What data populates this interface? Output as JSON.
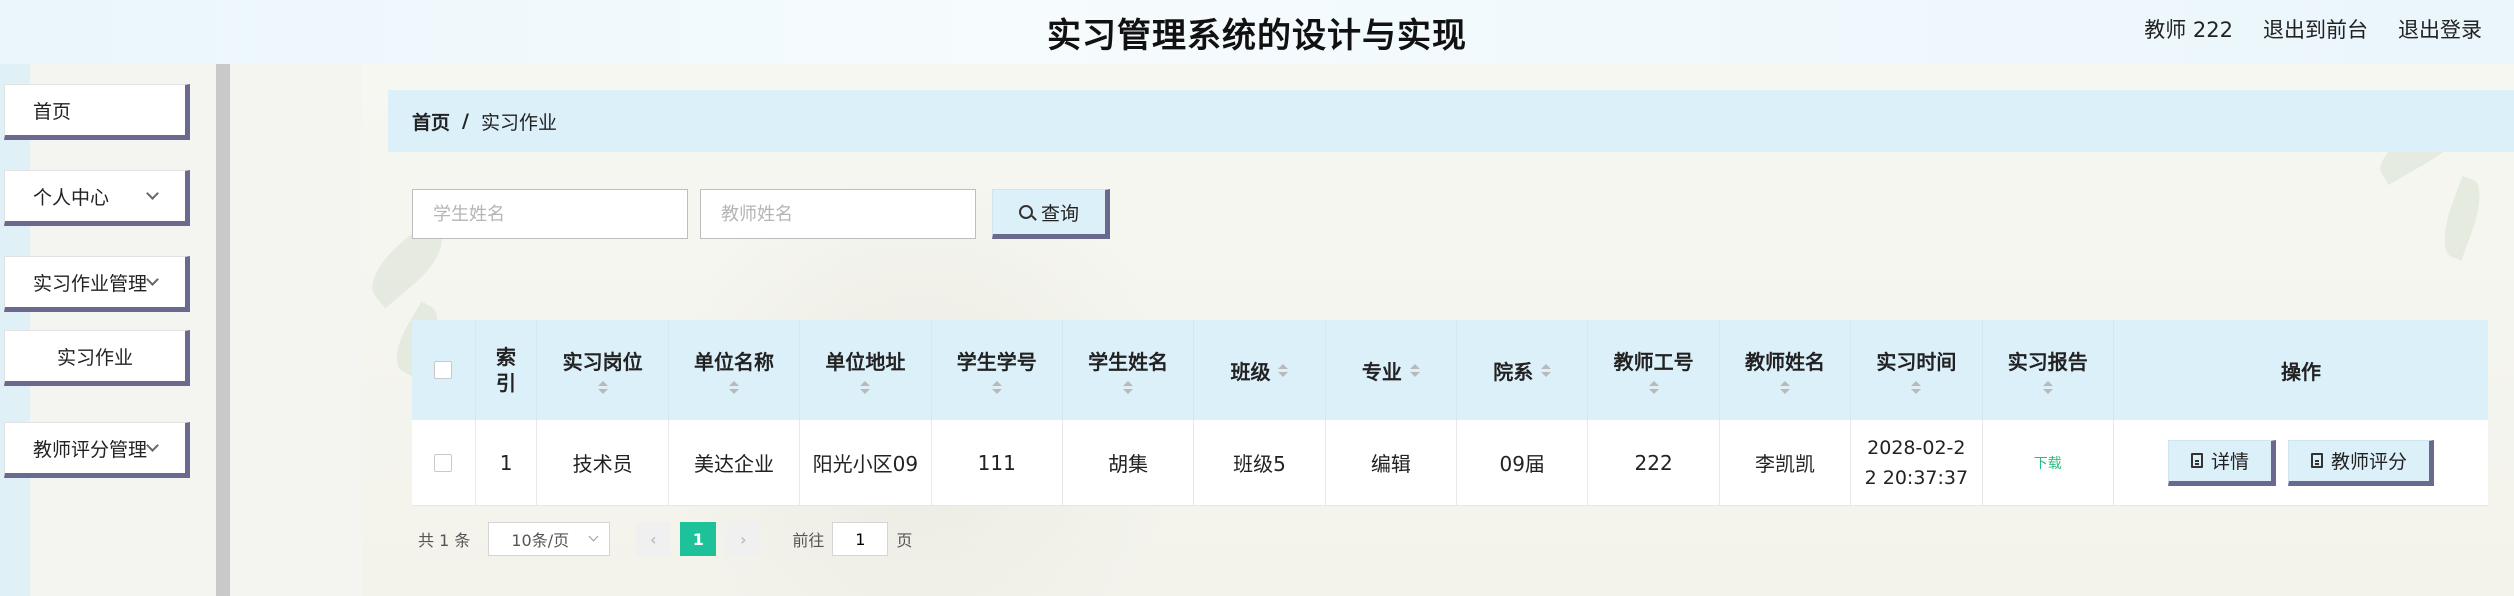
{
  "header": {
    "title": "实习管理系统的设计与实现",
    "user": "教师 222",
    "to_frontend": "退出到前台",
    "logout": "退出登录"
  },
  "sidebar": {
    "items": [
      {
        "label": "首页"
      },
      {
        "label": "个人中心"
      },
      {
        "label": "实习作业管理"
      },
      {
        "label": "实习作业"
      },
      {
        "label": "教师评分管理"
      }
    ]
  },
  "breadcrumb": {
    "home": "首页",
    "sep": "/",
    "current": "实习作业"
  },
  "search": {
    "student_placeholder": "学生姓名",
    "teacher_placeholder": "教师姓名",
    "button": "查询"
  },
  "table": {
    "headers": {
      "index": "索引",
      "post": "实习岗位",
      "company": "单位名称",
      "address": "单位地址",
      "student_no": "学生学号",
      "student_name": "学生姓名",
      "class": "班级",
      "major": "专业",
      "dept": "院系",
      "teacher_no": "教师工号",
      "teacher_name": "教师姓名",
      "time": "实习时间",
      "report": "实习报告",
      "ops": "操作"
    },
    "rows": [
      {
        "index": "1",
        "post": "技术员",
        "company": "美达企业",
        "address": "阳光小区09",
        "student_no": "111",
        "student_name": "胡集",
        "class": "班级5",
        "major": "编辑",
        "dept": "09届",
        "teacher_no": "222",
        "teacher_name": "李凯凯",
        "time": "2028-02-2\n2 20:37:37",
        "report": "下载",
        "detail": "详情",
        "score": "教师评分"
      }
    ]
  },
  "pager": {
    "total": "共 1 条",
    "size": "10条/页",
    "current": "1",
    "goto": "前往",
    "goto_value": "1",
    "page_unit": "页"
  }
}
